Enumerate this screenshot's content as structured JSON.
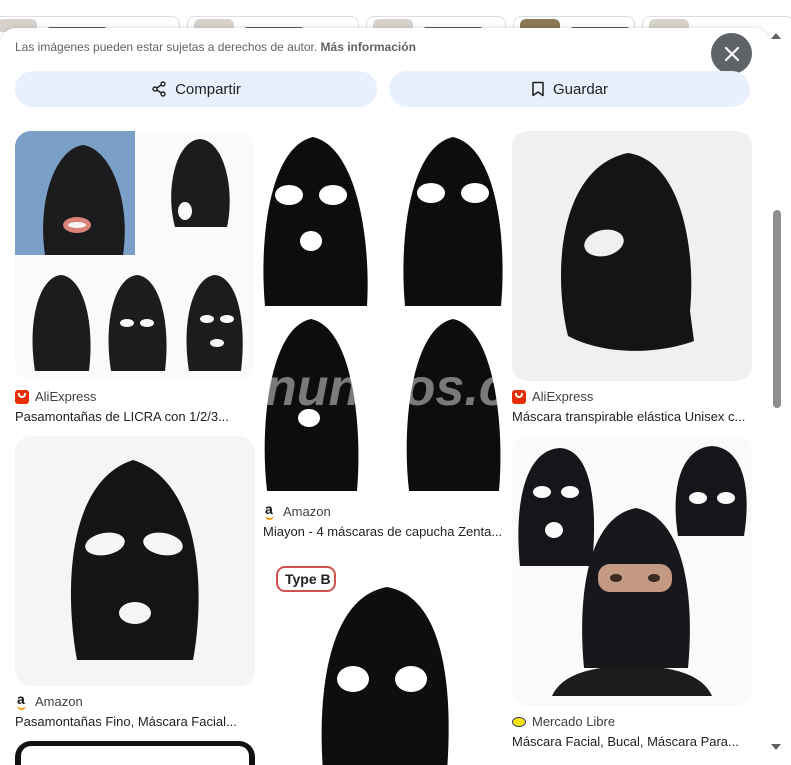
{
  "notice": {
    "text": "Las imágenes pueden estar sujetas a derechos de autor.",
    "link": "Más información"
  },
  "actions": {
    "share": "Compartir",
    "save": "Guardar"
  },
  "watermark": "nuncios.c",
  "results": [
    {
      "source": "AliExpress",
      "title": "Pasamontañas de LICRA con 1/2/3...",
      "favicon": "aliexpress-icon"
    },
    {
      "source": "Amazon",
      "title": "Miayon - 4 máscaras de capucha Zenta...",
      "favicon": "amazon-icon"
    },
    {
      "source": "AliExpress",
      "title": "Máscara transpirable elástica Unisex c...",
      "favicon": "aliexpress-icon"
    },
    {
      "source": "Amazon",
      "title": "Pasamontañas Fino, Máscara Facial...",
      "favicon": "amazon-icon"
    },
    {
      "source": "Mercado Libre",
      "title": "Máscara Facial, Bucal, Máscara Para...",
      "favicon": "mercadolibre-icon"
    }
  ],
  "badge": "Type B",
  "colors": {
    "accent_button_bg": "#e8f0fe",
    "close_button_bg": "#5f6368",
    "scrollbar_thumb": "#8e8e8e"
  }
}
